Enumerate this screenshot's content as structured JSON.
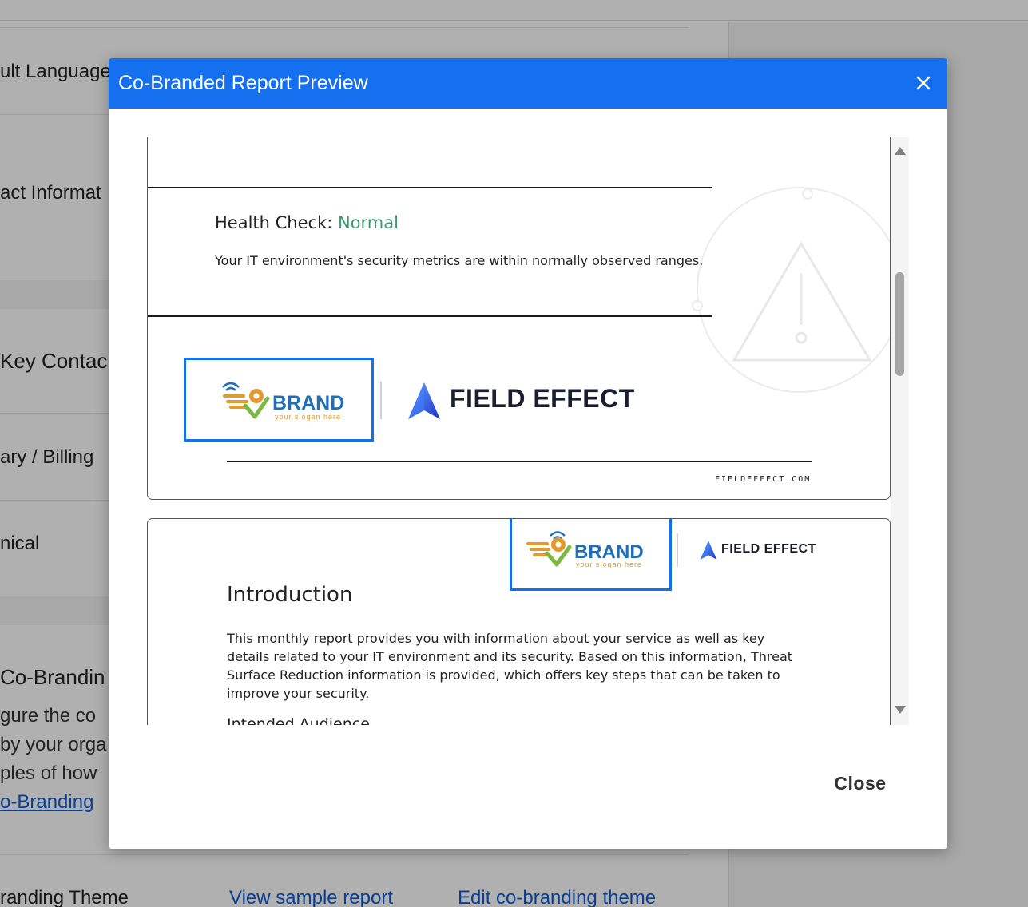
{
  "background": {
    "settings_rows": [
      {
        "label": "ult Language"
      },
      {
        "label": "act Informat"
      },
      {
        "label": "Key Contac"
      },
      {
        "label": "ary / Billing"
      },
      {
        "label": "nical"
      }
    ],
    "cobranding": {
      "title": "Co-Brandin",
      "desc_lines": [
        "gure the co",
        "by your orga",
        "ples of how"
      ],
      "link": "o-Branding"
    },
    "theme_row": {
      "label": "randing Theme",
      "view_sample": "View sample report",
      "edit_theme": "Edit co-branding theme"
    }
  },
  "modal": {
    "title": "Co-Branded Report Preview",
    "close_label": "Close",
    "colors": {
      "header": "#1570ef",
      "highlight": "#1570ef",
      "status_normal": "#3c9a6e"
    }
  },
  "report": {
    "health_check_label": "Health Check: ",
    "health_check_status": "Normal",
    "health_check_desc": "Your IT environment's security metrics are within normally observed ranges.",
    "brand_word": "BRAND",
    "brand_slogan": "your slogan here",
    "field_effect_word": "FIELD EFFECT",
    "url": "FIELDEFFECT.COM",
    "intro_title": "Introduction",
    "intro_body": "This monthly report provides you with information about your service as well as key details related to your IT environment and its security. Based on this information, Threat Surface Reduction information is provided, which offers key steps that can be taken to improve your security.",
    "intro_subheading": "Intended Audience"
  }
}
